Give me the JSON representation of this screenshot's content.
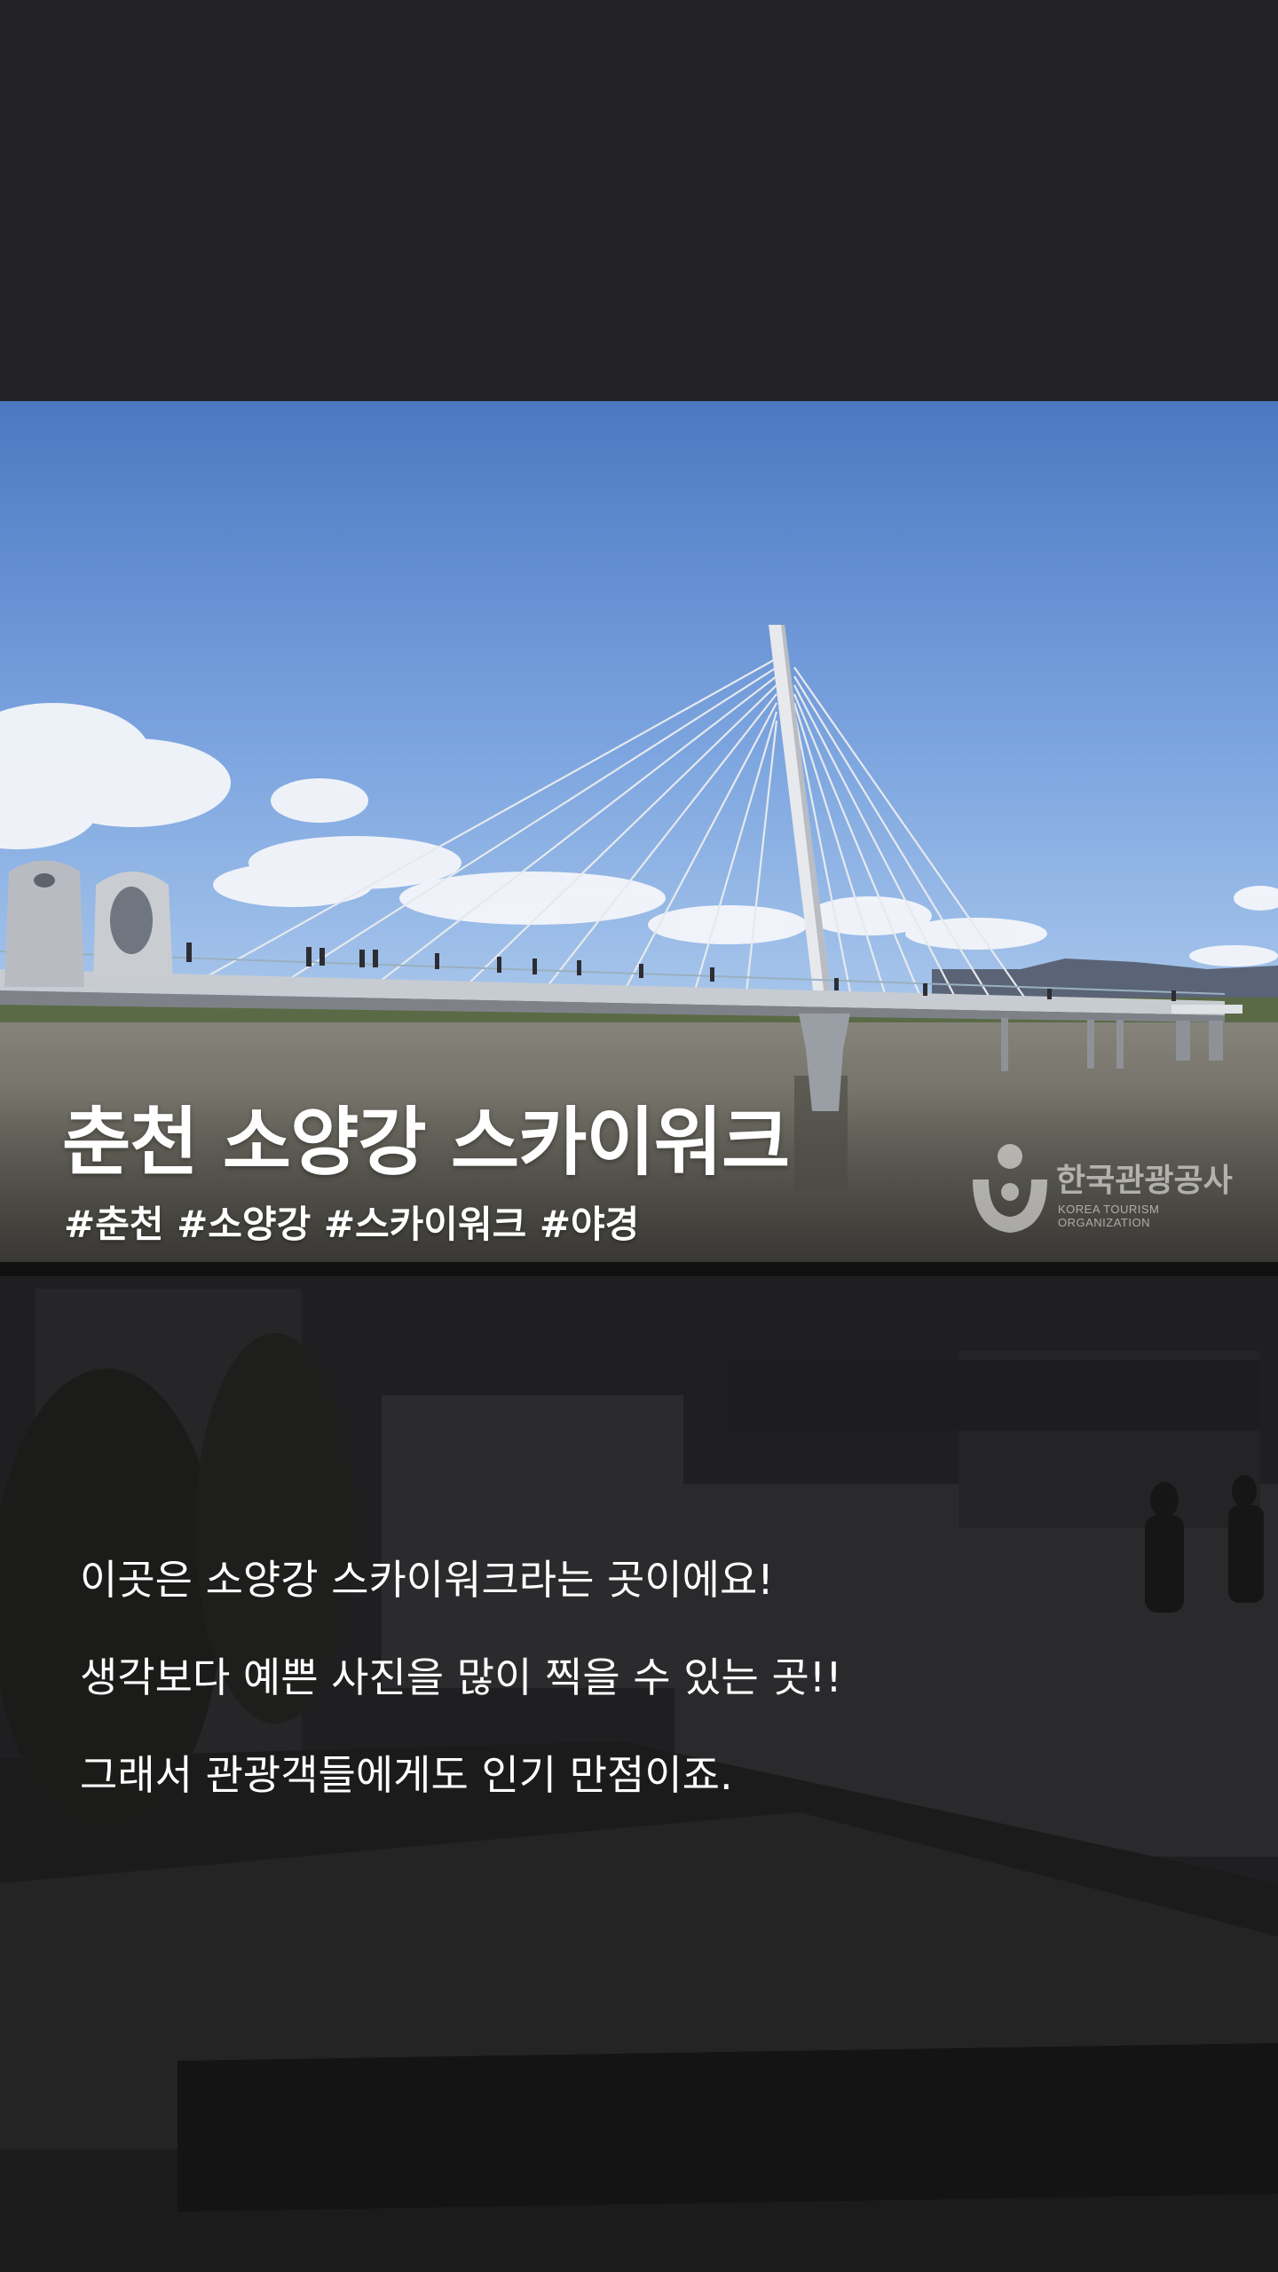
{
  "hero": {
    "title": "춘천 소양강 스카이워크",
    "tags": "#춘천 #소양강 #스카이워크 #야경",
    "photo_icon": "bridge-photo"
  },
  "watermark": {
    "name_ko": "한국관광공사",
    "name_en": "KOREA TOURISM ORGANIZATION"
  },
  "body": {
    "lines": [
      "이곳은 소양강 스카이워크라는 곳이에요!",
      "생각보다 예쁜 사진을 많이 찍을 수 있는 곳!!",
      "그래서 관광객들에게도 인기 만점이죠."
    ]
  },
  "colors": {
    "background": "#232325",
    "sky_top": "#4f7bc4",
    "sky_bottom": "#9fc0ea",
    "river": "#6b6a63",
    "text": "#ffffff"
  }
}
